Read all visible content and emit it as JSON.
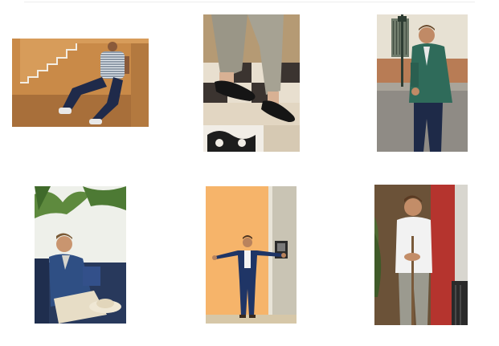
{
  "gallery": {
    "photos": [
      {
        "alt": ""
      },
      {
        "alt": ""
      },
      {
        "alt": ""
      },
      {
        "alt": ""
      },
      {
        "alt": ""
      },
      {
        "alt": ""
      }
    ]
  }
}
